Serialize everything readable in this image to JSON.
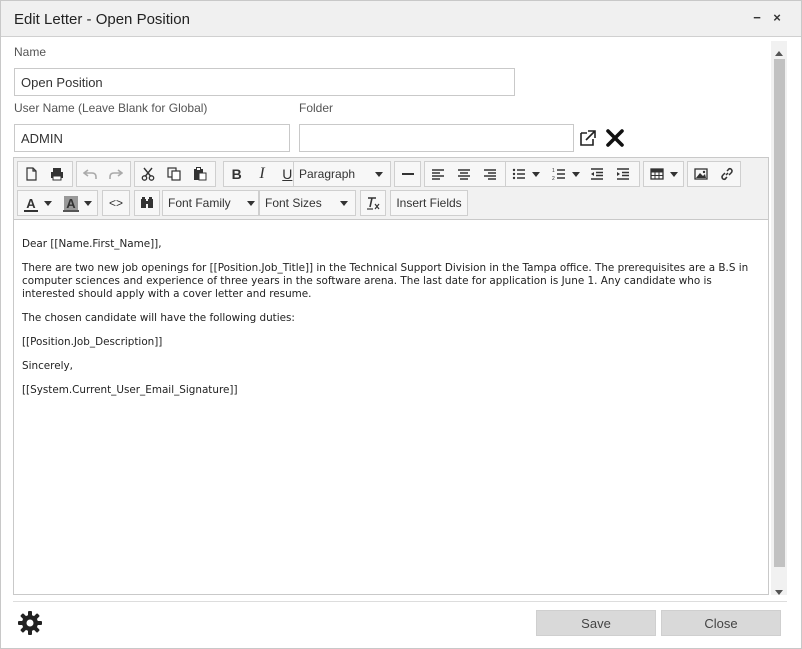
{
  "window": {
    "title": "Edit Letter - Open Position",
    "minimize_label": "−",
    "close_label": "×"
  },
  "form": {
    "name_label": "Name",
    "name_value": "Open Position",
    "username_label": "User Name (Leave Blank for Global)",
    "username_value": "ADMIN",
    "folder_label": "Folder",
    "folder_value": ""
  },
  "toolbar": {
    "paragraph_label": "Paragraph",
    "font_family_label": "Font Family",
    "font_sizes_label": "Font Sizes",
    "insert_fields_label": "Insert Fields",
    "bold": "B",
    "italic": "I",
    "underline": "U",
    "font_color": "A",
    "bg_color": "A",
    "source": "<>"
  },
  "content": {
    "paragraphs": [
      "Dear [[Name.First_Name]],",
      "There are two new job openings for [[Position.Job_Title]] in the Technical Support Division in the Tampa office. The prerequisites are a B.S in computer sciences and experience of three years in the software arena. The last date for application is June 1. Any candidate who is interested should apply with a cover letter and resume.",
      "The chosen candidate will have the following duties:",
      "[[Position.Job_Description]]",
      "Sincerely,",
      "[[System.Current_User_Email_Signature]]"
    ]
  },
  "footer": {
    "save_label": "Save",
    "close_label": "Close"
  }
}
